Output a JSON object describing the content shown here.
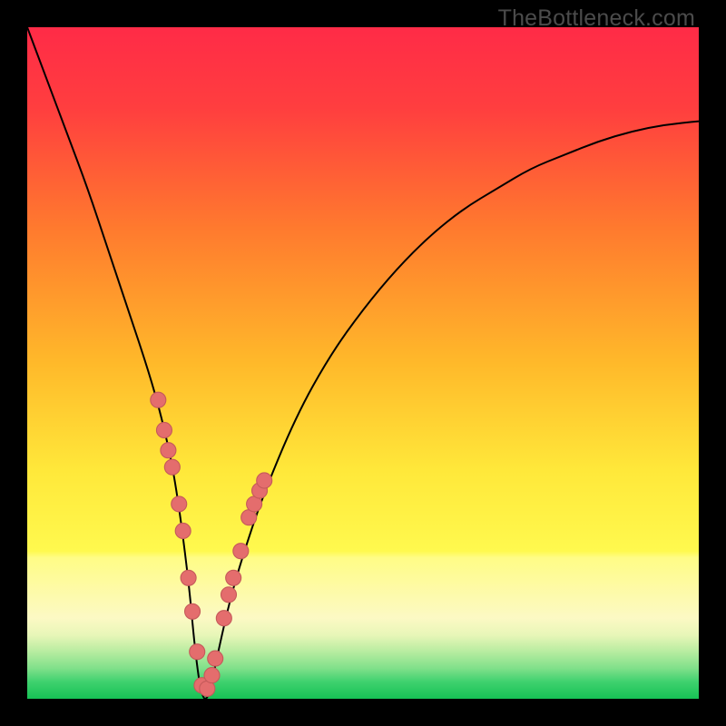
{
  "watermark": "TheBottleneck.com",
  "colors": {
    "frame": "#000000",
    "curve_stroke": "#000000",
    "dot_fill": "#e46d6d",
    "dot_stroke": "#c55a5a",
    "gradient_stops": [
      {
        "offset": 0.0,
        "color": "#ff2b47"
      },
      {
        "offset": 0.12,
        "color": "#ff3e3f"
      },
      {
        "offset": 0.3,
        "color": "#ff7a2e"
      },
      {
        "offset": 0.5,
        "color": "#ffb92a"
      },
      {
        "offset": 0.66,
        "color": "#ffe83a"
      },
      {
        "offset": 0.78,
        "color": "#fff94e"
      },
      {
        "offset": 0.79,
        "color": "#fffc86"
      },
      {
        "offset": 0.88,
        "color": "#fcf9c4"
      },
      {
        "offset": 0.905,
        "color": "#e8f6b8"
      },
      {
        "offset": 0.93,
        "color": "#b7eca0"
      },
      {
        "offset": 0.955,
        "color": "#7fe08a"
      },
      {
        "offset": 0.975,
        "color": "#3ed16e"
      },
      {
        "offset": 1.0,
        "color": "#17c255"
      }
    ]
  },
  "chart_data": {
    "type": "line",
    "title": "",
    "xlabel": "",
    "ylabel": "",
    "xlim": [
      0,
      100
    ],
    "ylim": [
      0,
      100
    ],
    "note": "y-axis inverted visually: 0 at bottom (green), 100 at top (red); curve shows absolute-value-like bottleneck metric with minimum near x≈26",
    "series": [
      {
        "name": "bottleneck-curve",
        "x": [
          0,
          3,
          6,
          9,
          12,
          15,
          18,
          20,
          22,
          24,
          25,
          26,
          27,
          28,
          30,
          32,
          35,
          40,
          45,
          50,
          55,
          60,
          65,
          70,
          75,
          80,
          85,
          90,
          95,
          100
        ],
        "y": [
          100,
          92,
          84,
          76,
          67,
          58,
          49,
          42,
          33,
          18,
          7,
          0,
          0,
          5,
          14,
          21,
          30,
          42,
          51,
          58,
          64,
          69,
          73,
          76,
          79,
          81,
          83,
          84.5,
          85.5,
          86
        ]
      }
    ],
    "highlight_points": {
      "name": "sample-dots",
      "x": [
        19.5,
        20.4,
        21.0,
        21.6,
        22.6,
        23.2,
        24.0,
        24.6,
        25.3,
        26.0,
        26.8,
        27.5,
        28.0,
        29.3,
        30.0,
        30.7,
        31.8,
        33.0,
        33.8,
        34.6,
        35.3
      ],
      "y": [
        44.5,
        40.0,
        37.0,
        34.5,
        29.0,
        25.0,
        18.0,
        13.0,
        7.0,
        2.0,
        1.5,
        3.5,
        6.0,
        12.0,
        15.5,
        18.0,
        22.0,
        27.0,
        29.0,
        31.0,
        32.5
      ]
    }
  }
}
